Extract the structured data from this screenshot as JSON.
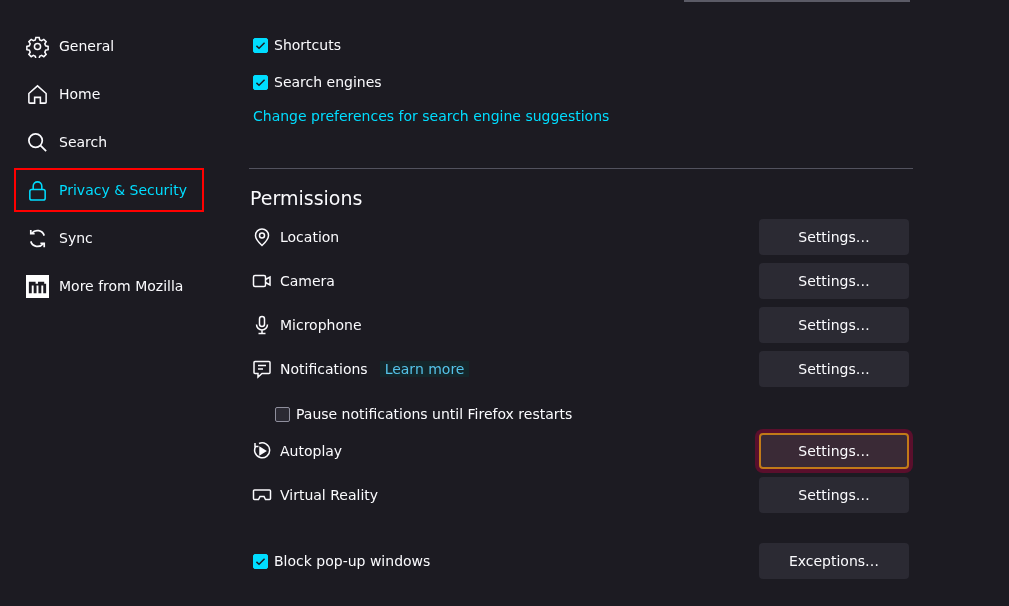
{
  "sidebar": {
    "items": [
      {
        "label": "General",
        "selected": false,
        "highlighted": false
      },
      {
        "label": "Home",
        "selected": false,
        "highlighted": false
      },
      {
        "label": "Search",
        "selected": false,
        "highlighted": false
      },
      {
        "label": "Privacy & Security",
        "selected": true,
        "highlighted": true
      },
      {
        "label": "Sync",
        "selected": false,
        "highlighted": false
      },
      {
        "label": "More from Mozilla",
        "selected": false,
        "highlighted": false
      }
    ]
  },
  "suggestions": {
    "checkboxes": [
      {
        "label": "Shortcuts",
        "checked": true
      },
      {
        "label": "Search engines",
        "checked": true
      }
    ],
    "link": "Change preferences for search engine suggestions"
  },
  "permissions": {
    "title": "Permissions",
    "rows": [
      {
        "kind": "permission",
        "label": "Location",
        "button": "Settings…",
        "highlighted": false
      },
      {
        "kind": "permission",
        "label": "Camera",
        "button": "Settings…",
        "highlighted": false
      },
      {
        "kind": "permission",
        "label": "Microphone",
        "button": "Settings…",
        "highlighted": false
      },
      {
        "kind": "permission",
        "label": "Notifications",
        "link": "Learn more",
        "button": "Settings…",
        "highlighted": false
      },
      {
        "kind": "checkbox",
        "label": "Pause notifications until Firefox restarts",
        "checked": false
      },
      {
        "kind": "permission",
        "label": "Autoplay",
        "button": "Settings…",
        "highlighted": true
      },
      {
        "kind": "permission",
        "label": "Virtual Reality",
        "button": "Settings…",
        "highlighted": false
      }
    ]
  },
  "popups": {
    "label": "Block pop-up windows",
    "checked": true,
    "button": "Exceptions…"
  }
}
